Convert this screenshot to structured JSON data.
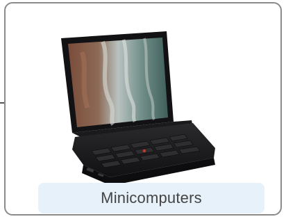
{
  "card": {
    "category_label": "Minicomputers",
    "image_icon": "mini-laptop-icon"
  },
  "colors": {
    "border": "#8a8a8a",
    "label_background": "#e6f1f9",
    "label_text": "#444444",
    "laptop_body": "#1c1c1e"
  }
}
